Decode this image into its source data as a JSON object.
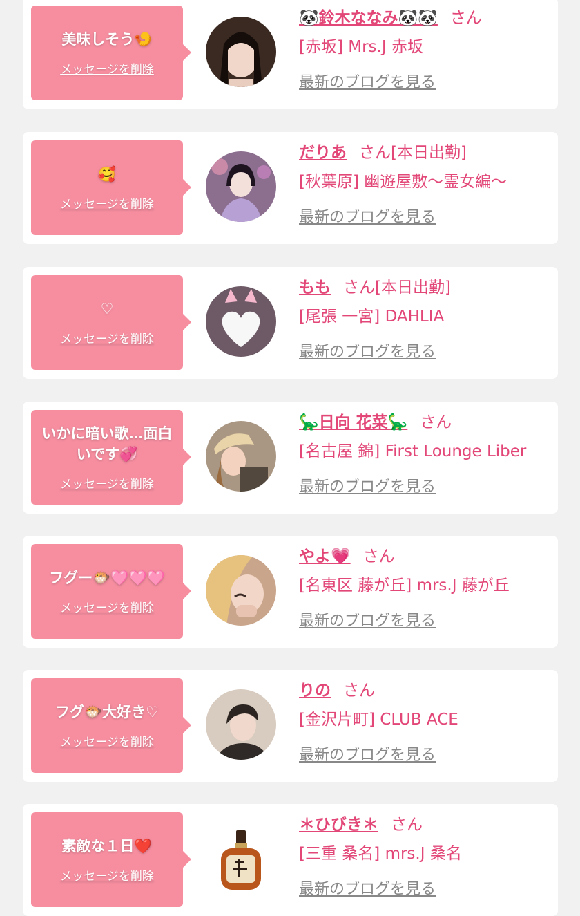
{
  "delete_label": "メッセージを削除",
  "blog_label": "最新のブログを見る",
  "cards": [
    {
      "message": "美味しそう🍤",
      "name": "🐼鈴木ななみ🐼🐼",
      "san": "さん",
      "status": "",
      "shop": "[赤坂] Mrs.J 赤坂",
      "avatar_icon": "photo-woman-dark-hair"
    },
    {
      "message": "🥰",
      "name": "だりあ",
      "san": "さん",
      "status": "[本日出勤]",
      "shop": "[秋葉原] 幽遊屋敷〜霊女編〜",
      "avatar_icon": "photo-woman-lavender"
    },
    {
      "message": "♡",
      "name": "もも",
      "san": "さん",
      "status": "[本日出勤]",
      "shop": "[尾張 一宮] DAHLIA",
      "avatar_icon": "heart-cat-ears-icon"
    },
    {
      "message": "いかに暗い歌…面白いです💞",
      "name": "🦕日向 花菜🦕",
      "san": "さん",
      "status": "",
      "shop": "[名古屋 錦] First Lounge Liber",
      "avatar_icon": "photo-woman-cap"
    },
    {
      "message": "フグー🐡🩷🩷🩷",
      "name": "やよ💗",
      "san": "さん",
      "status": "",
      "shop": "[名東区 藤が丘] mrs.J 藤が丘",
      "avatar_icon": "photo-woman-blonde"
    },
    {
      "message": "フグ🐡大好き♡",
      "name": "りの",
      "san": "さん",
      "status": "",
      "shop": "[金沢片町] CLUB ACE",
      "avatar_icon": "photo-woman-short-hair"
    },
    {
      "message": "素敵な１日❤️",
      "name": "＊ひびき＊",
      "san": "さん",
      "status": "",
      "shop": "[三重 桑名] mrs.J 桑名",
      "avatar_icon": "whisky-bottle-icon"
    }
  ]
}
